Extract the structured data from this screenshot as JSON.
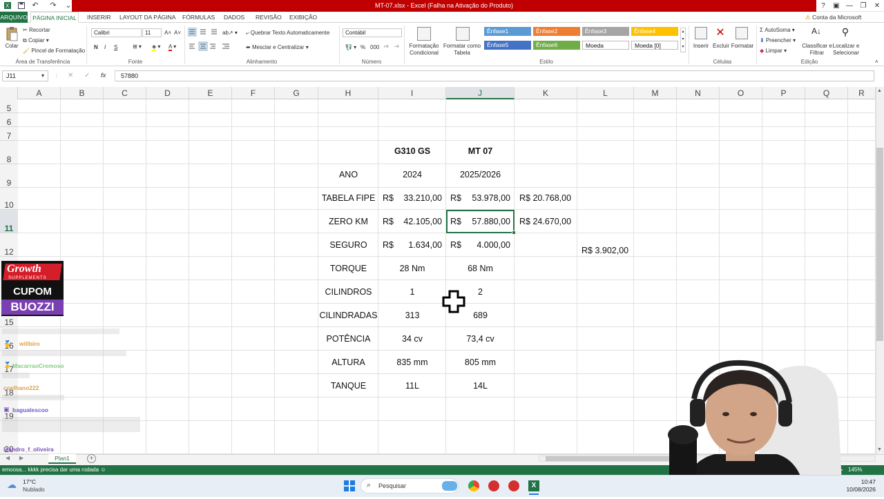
{
  "window": {
    "title": "MT-07.xlsx - Excel (Falha na Ativação do Produto)",
    "controls": [
      "?",
      "▣",
      "—",
      "❐",
      "✕"
    ]
  },
  "tabs": [
    "ARQUIVO",
    "PÁGINA INICIAL",
    "INSERIR",
    "LAYOUT DA PÁGINA",
    "FÓRMULAS",
    "DADOS",
    "REVISÃO",
    "EXIBIÇÃO"
  ],
  "account": "Conta da Microsoft",
  "ribbon": {
    "clipboard": {
      "paste": "Colar",
      "cut": "Recortar",
      "copy": "Copiar",
      "format_painter": "Pincel de Formatação",
      "label": "Área de Transferência"
    },
    "font": {
      "name": "Calibri",
      "size": "11",
      "bold": "N",
      "italic": "I",
      "underline": "S",
      "label": "Fonte"
    },
    "alignment": {
      "wrap": "Quebrar Texto Automaticamente",
      "merge": "Mesclar e Centralizar",
      "label": "Alinhamento"
    },
    "number": {
      "format": "Contábil",
      "percent": "%",
      "thousands": "000",
      "label": "Número"
    },
    "styles": {
      "conditional": "Formatação Condicional",
      "as_table": "Formatar como Tabela",
      "label": "Estilo",
      "cells": [
        {
          "name": "Ênfase1",
          "color": "#5b9bd5"
        },
        {
          "name": "Ênfase2",
          "color": "#ed7d31"
        },
        {
          "name": "Ênfase3",
          "color": "#a5a5a5"
        },
        {
          "name": "Ênfase4",
          "color": "#ffc000"
        },
        {
          "name": "Ênfase5",
          "color": "#4472c4"
        },
        {
          "name": "Ênfase6",
          "color": "#70ad47"
        },
        {
          "name": "Moeda",
          "color": "#ffffff"
        },
        {
          "name": "Moeda [0]",
          "color": "#ffffff"
        }
      ]
    },
    "cells": {
      "insert": "Inserir",
      "delete": "Excluir",
      "format": "Formatar",
      "label": "Células"
    },
    "editing": {
      "autosum": "AutoSoma",
      "fill": "Preencher",
      "clear": "Limpar",
      "sort": "Classificar e Filtrar",
      "find": "Localizar e Selecionar",
      "label": "Edição"
    }
  },
  "formula_bar": {
    "name_box": "J11",
    "fx": "fx",
    "value": "57880"
  },
  "columns": [
    "A",
    "B",
    "C",
    "D",
    "E",
    "F",
    "G",
    "H",
    "I",
    "J",
    "K",
    "L",
    "M",
    "N",
    "O",
    "P",
    "Q",
    "R"
  ],
  "rows": [
    "5",
    "6",
    "7",
    "8",
    "9",
    "10",
    "11",
    "12",
    "13",
    "14",
    "15",
    "16",
    "17",
    "18",
    "19",
    "20"
  ],
  "sheet": {
    "header": {
      "i": "G310 GS",
      "j": "MT 07"
    },
    "table": [
      {
        "label": "ANO",
        "i": "2024",
        "j": "2025/2026"
      },
      {
        "label": "TABELA FIPE",
        "i_cur": "R$",
        "i": "33.210,00",
        "j_cur": "R$",
        "j": "53.978,00",
        "k": "R$ 20.768,00"
      },
      {
        "label": "ZERO KM",
        "i_cur": "R$",
        "i": "42.105,00",
        "j_cur": "R$",
        "j": "57.880,00",
        "k": "R$ 24.670,00"
      },
      {
        "label": "SEGURO",
        "i_cur": "R$",
        "i": "1.634,00",
        "j_cur": "R$",
        "j": "4.000,00",
        "l": "R$ 3.902,00"
      },
      {
        "label": "TORQUE",
        "i": "28 Nm",
        "j": "68 Nm"
      },
      {
        "label": "CILINDROS",
        "i": "1",
        "j": "2"
      },
      {
        "label": "CILINDRADAS",
        "i": "313",
        "j": "689"
      },
      {
        "label": "POTÊNCIA",
        "i": "34 cv",
        "j": "73,4 cv"
      },
      {
        "label": "ALTURA",
        "i": "835 mm",
        "j": "805 mm"
      },
      {
        "label": "TANQUE",
        "i": "11L",
        "j": "14L"
      }
    ]
  },
  "sheet_tab": "Plan1",
  "status": {
    "zoom": "145%"
  },
  "overlay": {
    "promo": {
      "brand": "Growth",
      "sub": "SUPPLEMENTS",
      "line1": "CUPOM",
      "line2": "BUOZZI"
    },
    "chat": [
      {
        "name": "willbiro",
        "color": "#e0a040"
      },
      {
        "name": "MacarraoCremoso",
        "color": "#7fd07f"
      },
      {
        "name": "coelhano222",
        "color": "#d8a050"
      },
      {
        "name": "bagualescoo",
        "color": "#6a5acd"
      },
      {
        "name": "leandro_f_oliveira",
        "color": "#7b4fb8"
      }
    ],
    "ticker": "emoosa... kkkk precisa dar uma rodada"
  },
  "taskbar": {
    "weather_temp": "17°C",
    "weather_desc": "Nublado",
    "search": "Pesquisar",
    "time": "10:47",
    "date": "10/08/2026"
  }
}
